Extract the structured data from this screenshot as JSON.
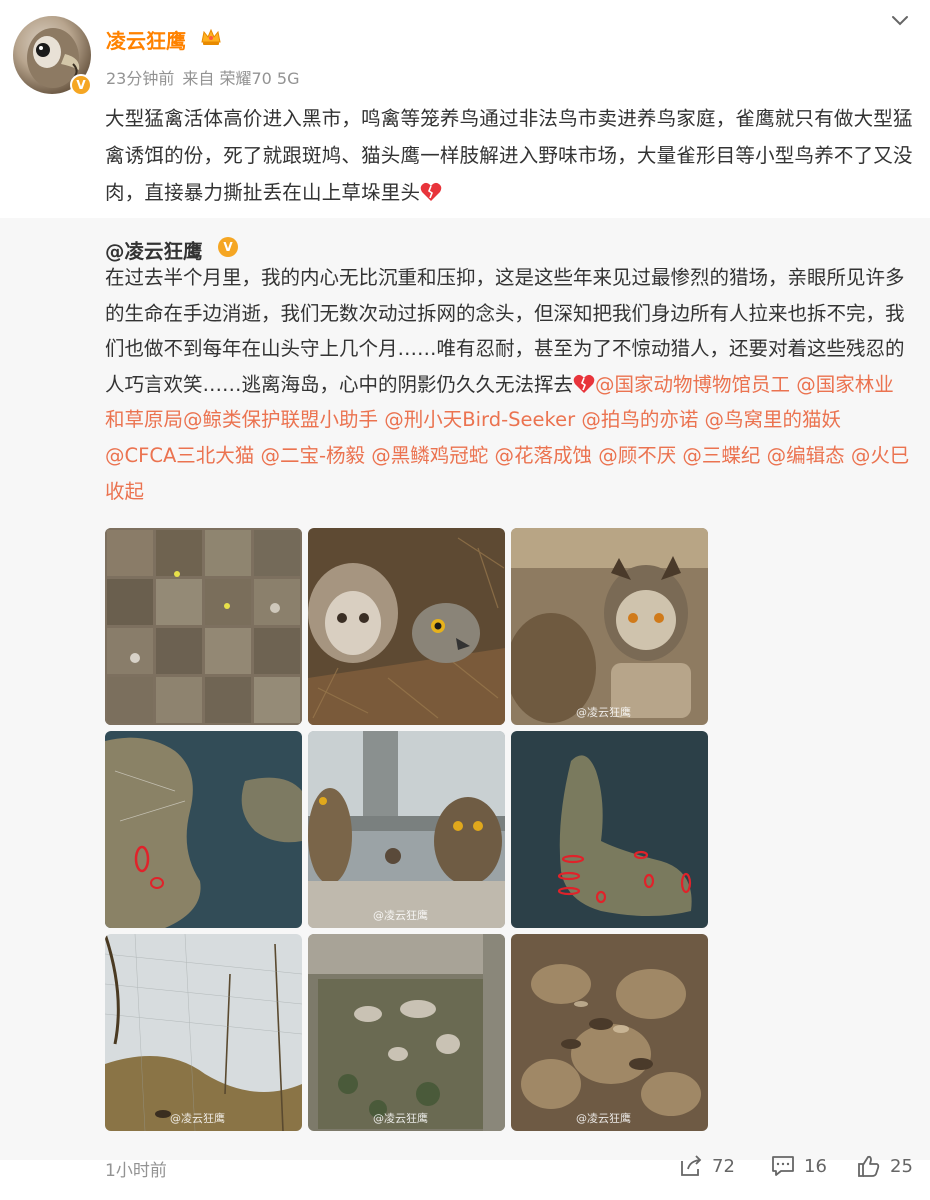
{
  "header": {
    "username": "凌云狂鹰",
    "badge": "V",
    "time": "23分钟前",
    "source": "来自 荣耀70 5G"
  },
  "post": {
    "text": "大型猛禽活体高价进入黑市，鸣禽等笼养鸟通过非法鸟市卖进养鸟家庭，雀鹰就只有做大型猛禽诱饵的份，死了就跟斑鸠、猫头鹰一样肢解进入野味市场，大量雀形目等小型鸟养不了又没肉，直接暴力撕扯丢在山上草垛里头"
  },
  "repost": {
    "username": "@凌云狂鹰",
    "badge": "V",
    "text": "在过去半个月里，我的内心无比沉重和压抑，这是这些年来见过最惨烈的猎场，亲眼所见许多的生命在手边消逝，我们无数次动过拆网的念头，但深知把我们身边所有人拉来也拆不完，我们也做不到每年在山头守上几个月……唯有忍耐，甚至为了不惊动猎人，还要对着这些残忍的人巧言欢笑……逃离海岛，心中的阴影仍久久无法挥去",
    "mentions": [
      "@国家动物博物馆员工",
      "@国家林业和草原局",
      "@鲸类保护联盟小助手",
      "@刑小天Bird-Seeker",
      "@拍鸟的亦诺",
      "@鸟窝里的猫妖",
      "@CFCA三北大猫",
      "@二宝-杨毅",
      "@黑鳞鸡冠蛇",
      "@花落成蚀",
      "@顾不厌",
      "@三蝶纪",
      "@编辑态",
      "@火巳"
    ],
    "collapse": "收起",
    "watermark": "@凌云狂鹰"
  },
  "footer": {
    "time": "1小时前",
    "share_count": "72",
    "comment_count": "16",
    "like_count": "25"
  },
  "colors": {
    "accent": "#ff8200",
    "link": "#eb7350",
    "meta": "#939393",
    "repost_bg": "#f7f7f7"
  },
  "icons": [
    "avatar",
    "vip-crown-icon",
    "verified-badge-icon",
    "chevron-down-icon",
    "broken-heart-icon",
    "share-icon",
    "comment-icon",
    "like-icon"
  ]
}
